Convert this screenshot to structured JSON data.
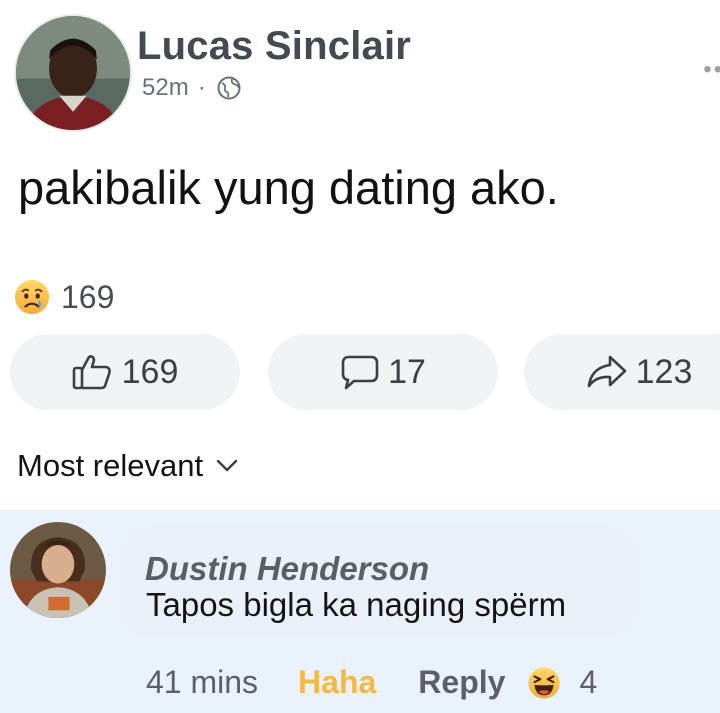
{
  "post": {
    "author": "Lucas Sinclair",
    "time": "52m",
    "separator": "·",
    "text": "pakibalik yung dating ako.",
    "more_label": "••",
    "reactions": {
      "icon": "sad-face-icon",
      "count": "169"
    },
    "actions": {
      "like": {
        "icon": "thumbs-up-icon",
        "count": "169"
      },
      "comment": {
        "icon": "comment-bubble-icon",
        "count": "17"
      },
      "share": {
        "icon": "share-arrow-icon",
        "count": "123"
      }
    }
  },
  "comments_sort": {
    "label": "Most relevant",
    "icon": "chevron-down-icon"
  },
  "comment": {
    "author": "Dustin Henderson",
    "text": "Tapos bigla ka naging spërm",
    "time": "41 mins",
    "haha_label": "Haha",
    "reply_label": "Reply",
    "reaction_icon": "laughing-face-icon",
    "reaction_count": "4"
  },
  "colors": {
    "author_name": "#444a52",
    "haha_active": "#f3b845",
    "comment_section_bg": "#e9f2fb",
    "action_button_bg": "#f1f2f4"
  }
}
